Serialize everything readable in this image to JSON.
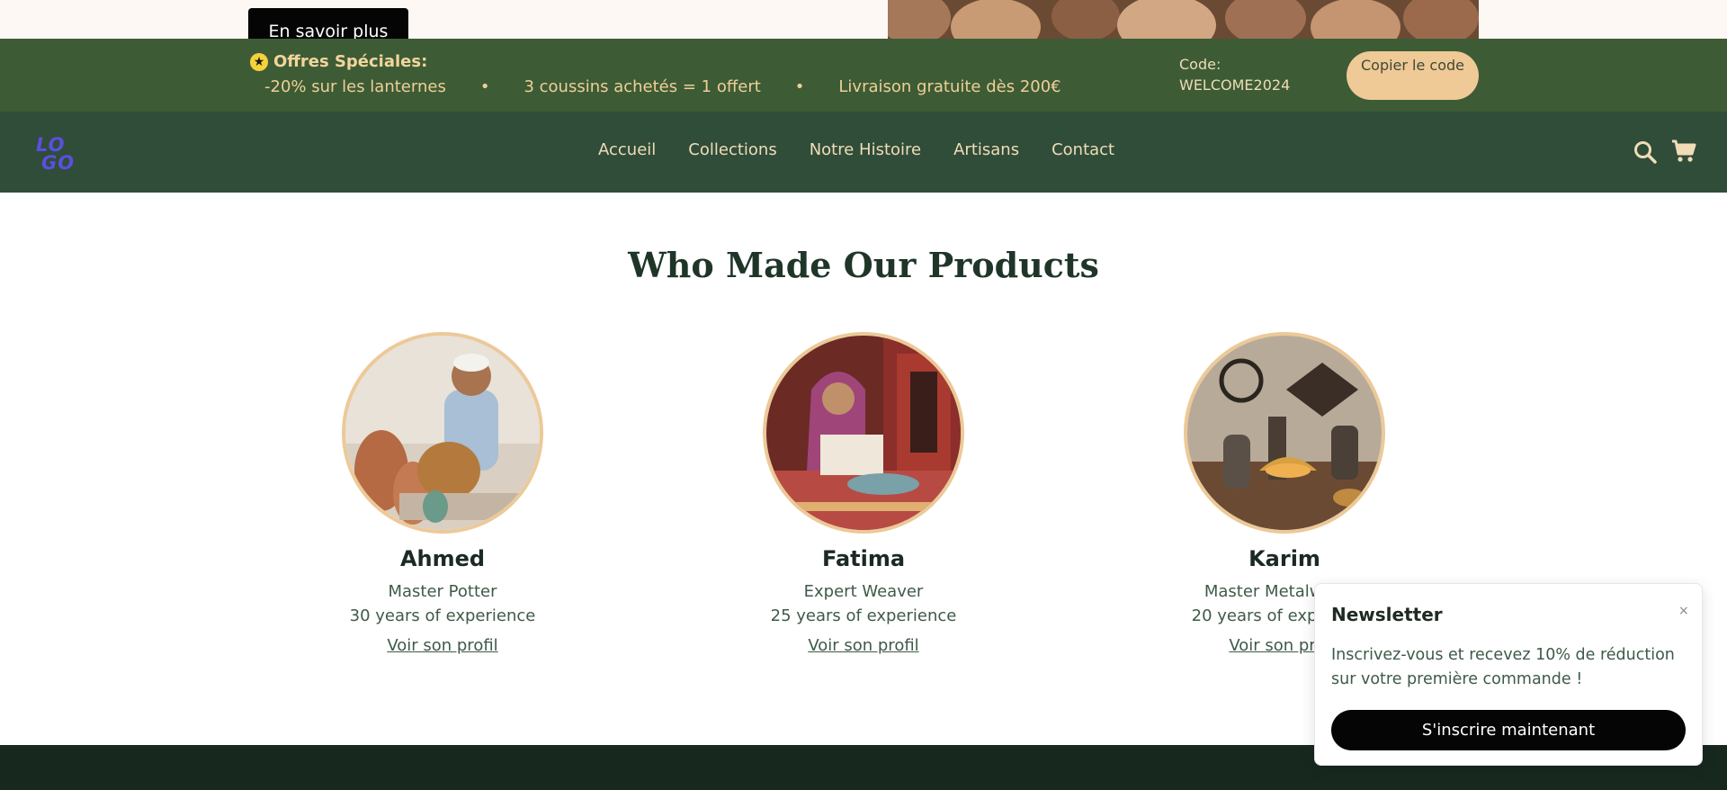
{
  "hero": {
    "button_label": "En savoir plus"
  },
  "promo": {
    "title": "Offres Spéciales:",
    "items": [
      "-20% sur les lanternes",
      "3 coussins achetés = 1 offert",
      "Livraison gratuite dès 200€"
    ],
    "separator": "•",
    "code_label": "Code:",
    "code_value": "WELCOME2024",
    "copy_label": "Copier le code"
  },
  "nav": {
    "logo_text": "LOGO",
    "links": [
      "Accueil",
      "Collections",
      "Notre Histoire",
      "Artisans",
      "Contact"
    ],
    "icons": [
      "search-icon",
      "cart-icon"
    ]
  },
  "artisans": {
    "title": "Who Made Our Products",
    "items": [
      {
        "name": "Ahmed",
        "role": "Master Potter",
        "experience": "30 years of experience",
        "link_label": "Voir son profil"
      },
      {
        "name": "Fatima",
        "role": "Expert Weaver",
        "experience": "25 years of experience",
        "link_label": "Voir son profil"
      },
      {
        "name": "Karim",
        "role": "Master Metalworker",
        "experience": "20 years of experience",
        "link_label": "Voir son profil"
      }
    ]
  },
  "newsletter": {
    "title": "Newsletter",
    "close_label": "×",
    "text": "Inscrivez-vous et recevez 10% de réduction sur votre première commande !",
    "button_label": "S'inscrire maintenant"
  },
  "colors": {
    "promo_bg": "#3d5c36",
    "nav_bg": "#2f4d39",
    "accent": "#efc996",
    "footer_bg": "#17291f"
  }
}
